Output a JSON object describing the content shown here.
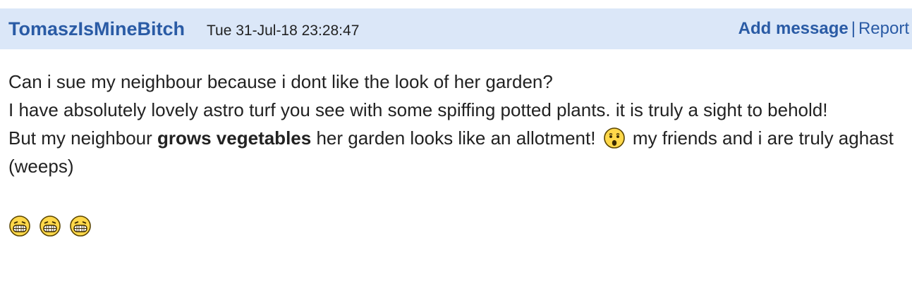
{
  "post": {
    "username": "TomaszIsMineBitch",
    "timestamp": "Tue 31-Jul-18 23:28:47",
    "actions": {
      "add_message": "Add message",
      "separator": "|",
      "report": "Report"
    },
    "body": {
      "line1": "Can i sue my neighbour because i dont like the look of her garden?",
      "line2": "I have absolutely lovely astro turf you see with some spiffing potted plants. it is truly a sight to behold!",
      "line3_before": "But my neighbour ",
      "line3_bold": "grows vegetables",
      "line3_after": " her garden looks like an allotment!",
      "line3_after_emoji": " my friends and i are truly aghast (weeps)"
    },
    "emojis": {
      "inline": "shocked-face-icon",
      "laughing": [
        "laughing-face-icon",
        "laughing-face-icon",
        "laughing-face-icon"
      ]
    }
  }
}
